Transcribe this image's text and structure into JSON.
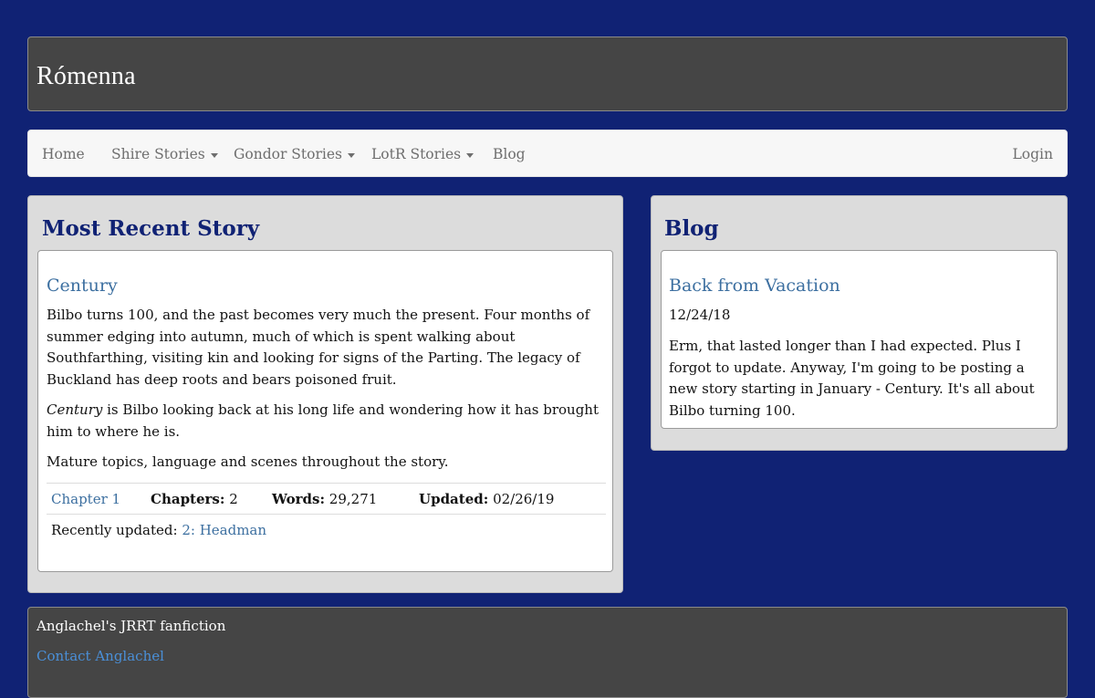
{
  "site": {
    "title": "Rómenna"
  },
  "nav": {
    "items": [
      {
        "label": "Home"
      },
      {
        "label": "Shire Stories"
      },
      {
        "label": "Gondor Stories"
      },
      {
        "label": "LotR Stories"
      },
      {
        "label": "Blog"
      }
    ],
    "login": "Login"
  },
  "recent_story": {
    "heading": "Most Recent Story",
    "title": "Century",
    "summary": "Bilbo turns 100, and the past becomes very much the present. Four months of summer edging into autumn, much of which is spent walking about Southfarthing, visiting kin and looking for signs of the Parting. The legacy of Buckland has deep roots and bears poisoned fruit.",
    "note_italic": "Century",
    "note_rest": " is Bilbo looking back at his long life and wondering how it has brought him to where he is.",
    "warning": "Mature topics, language and scenes throughout the story.",
    "chapter_link": "Chapter 1",
    "chapters_label": "Chapters:",
    "chapters_value": "2",
    "words_label": "Words:",
    "words_value": "29,271",
    "updated_label": "Updated:",
    "updated_value": "02/26/19",
    "recent_label": "Recently updated:",
    "recent_link": "2: Headman"
  },
  "blog": {
    "heading": "Blog",
    "post_title": "Back from Vacation",
    "post_date": "12/24/18",
    "post_body": "Erm, that lasted longer than I had expected. Plus I forgot to update. Anyway, I'm going to be posting a new story starting in January - Century. It's all about Bilbo turning 100."
  },
  "footer": {
    "title": "Anglachel's JRRT fanfiction",
    "contact": "Contact Anglachel"
  }
}
